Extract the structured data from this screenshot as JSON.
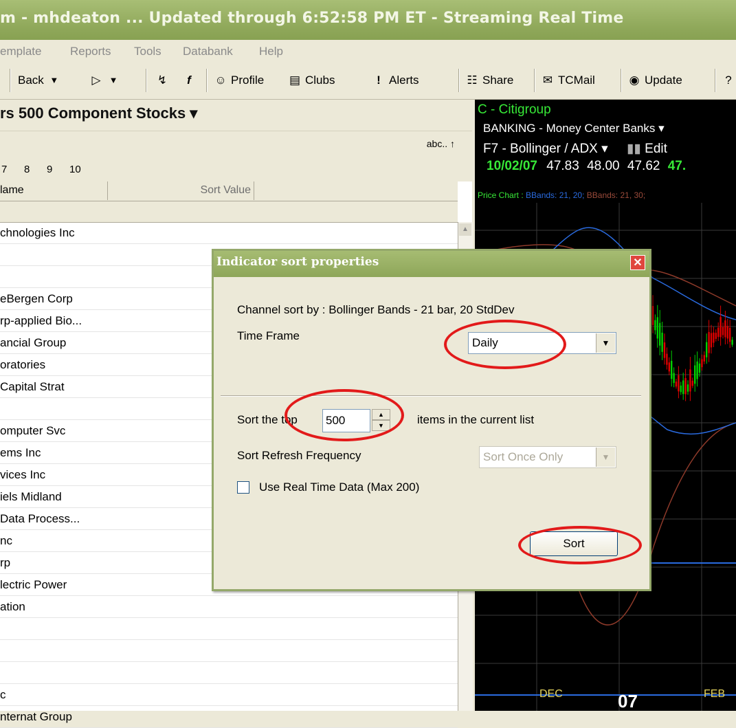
{
  "window": {
    "title": "m - mhdeaton  ... Updated through 6:52:58 PM ET  -  Streaming Real Time"
  },
  "menu": [
    "emplate",
    "Reports",
    "Tools",
    "Databank",
    "Help"
  ],
  "toolbar": {
    "back": "Back",
    "profile": "Profile",
    "clubs": "Clubs",
    "alerts": "Alerts",
    "share": "Share",
    "tcmail": "TCMail",
    "update": "Update"
  },
  "watchlist": {
    "title": "rs 500 Component Stocks ▾",
    "sort_label": "abc.. ↑",
    "tabs": [
      "7",
      "8",
      "9",
      "10"
    ],
    "col_name": "lame",
    "col_sort": "Sort Value",
    "rows": [
      "chnologies Inc",
      "",
      "",
      "eBergen Corp",
      "rp-applied Bio...",
      "ancial Group",
      "oratories",
      "Capital Strat",
      "",
      "omputer Svc",
      "ems Inc",
      "vices Inc",
      "iels Midland",
      "Data Process...",
      "nc",
      "rp",
      "lectric Power",
      "ation",
      "",
      "",
      "",
      "c",
      "nternat Group"
    ]
  },
  "chart": {
    "symbol": "C - Citigroup",
    "industry": "BANKING - Money Center Banks ▾",
    "template": "F7 - Bollinger / ADX ▾",
    "edit": "Edit",
    "date": "10/02/07",
    "open": "47.83",
    "high": "48.00",
    "low": "47.62",
    "close": "47.",
    "legend_price": "Price Chart :",
    "legend_bb1": "BBands: 21, 20;",
    "legend_bb2": "BBands: 21, 30;",
    "axis_dec": "DEC",
    "axis_year": "07",
    "axis_feb": "FEB",
    "colors": {
      "price_up": "#00E000",
      "price_down": "#E00000",
      "bb1": "#2A6BE0",
      "bb2": "#8E3A2A"
    }
  },
  "dialog": {
    "title": "Indicator sort properties",
    "channel_label": "Channel sort by : Bollinger Bands - 21 bar, 20 StdDev",
    "timeframe_label": "Time Frame",
    "timeframe_value": "Daily",
    "sort_top_label": "Sort the top",
    "sort_top_value": "500",
    "items_label": "items in the current list",
    "refresh_label": "Sort Refresh Frequency",
    "refresh_value": "Sort Once Only",
    "realtime_label": "Use Real Time Data (Max 200)",
    "realtime_checked": false,
    "sort_button": "Sort"
  }
}
